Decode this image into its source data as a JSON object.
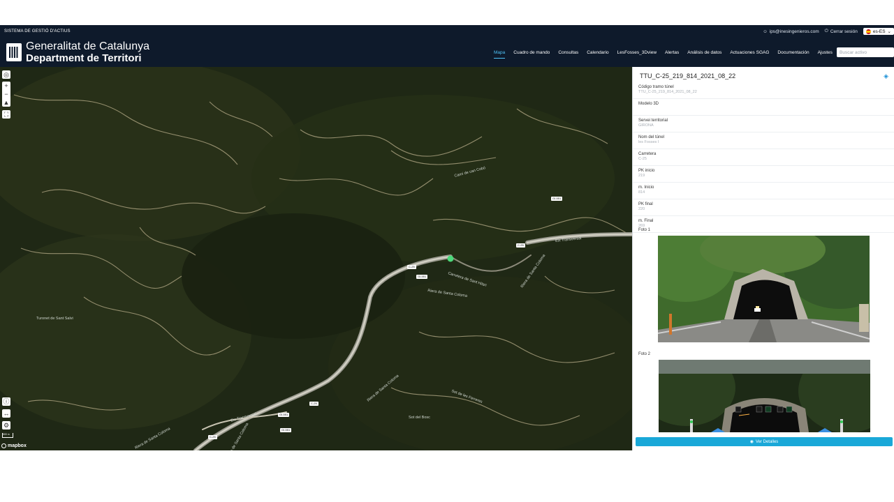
{
  "header": {
    "system_name": "SISTEMA DE GESTIÓ D'ACTIUS",
    "user_email": "ips@inesingenieros.com",
    "logout_label": "Cerrar sesión",
    "language": "es-ES",
    "logo_line1": "Generalitat de Catalunya",
    "logo_line2": "Department de Territori",
    "search_placeholder": "Buscar activo"
  },
  "nav": {
    "items": [
      "Mapa",
      "Cuadro de mando",
      "Consultas",
      "Calendario",
      "LesFosses_3Dview",
      "Alertas",
      "Análisis de datos",
      "Actuaciones SGAG",
      "Documentación",
      "Ajustes"
    ],
    "active": "Mapa"
  },
  "map": {
    "labels": {
      "place": "Turonet de Sant Salvi",
      "road1": "Carretera de Sant Hilari",
      "road2": "Eix Transversal",
      "road3": "Eix Transversal",
      "river1": "Riera de Santa Coloma",
      "river2": "Riera de Santa Coloma",
      "river3": "Riera de Santa Coloma",
      "river4": "Riera de Santa Coloma",
      "river5": "Riera de Santa Coloma",
      "sot1": "Sot de les Ferreres",
      "sot2": "Sot del Bosc",
      "camí": "Camí de can Cobó"
    },
    "shields": [
      "GI-551",
      "C-25",
      "C-25",
      "GI-551",
      "C-25",
      "C-25",
      "GI-551",
      "GI-551"
    ],
    "scale_label": "500 m",
    "attribution": "mapbox"
  },
  "panel": {
    "title": "TTU_C-25_219_814_2021_08_22",
    "fields": [
      {
        "label": "Código tramo túnel",
        "value": "TTU_C-25_219_814_2021_08_22"
      },
      {
        "label": "Modelo 3D",
        "value": ""
      },
      {
        "label": "Servei territorial",
        "value": "GIRONA"
      },
      {
        "label": "Nom del túnel",
        "value": "les Fosses I"
      },
      {
        "label": "Carretera",
        "value": "C-25"
      },
      {
        "label": "PK inicio",
        "value": "219"
      },
      {
        "label": "m. Inicio",
        "value": "814"
      },
      {
        "label": "PK final",
        "value": "220"
      },
      {
        "label": "m. Final",
        "value": "269"
      }
    ],
    "photo1_label": "Foto 1",
    "photo2_label": "Foto 2",
    "details_button": "Ver Detalles"
  },
  "colors": {
    "header_bg": "#0e1a2b",
    "accent": "#4fc3f7",
    "button": "#1aa8d8",
    "marker": "#4cd97b"
  }
}
